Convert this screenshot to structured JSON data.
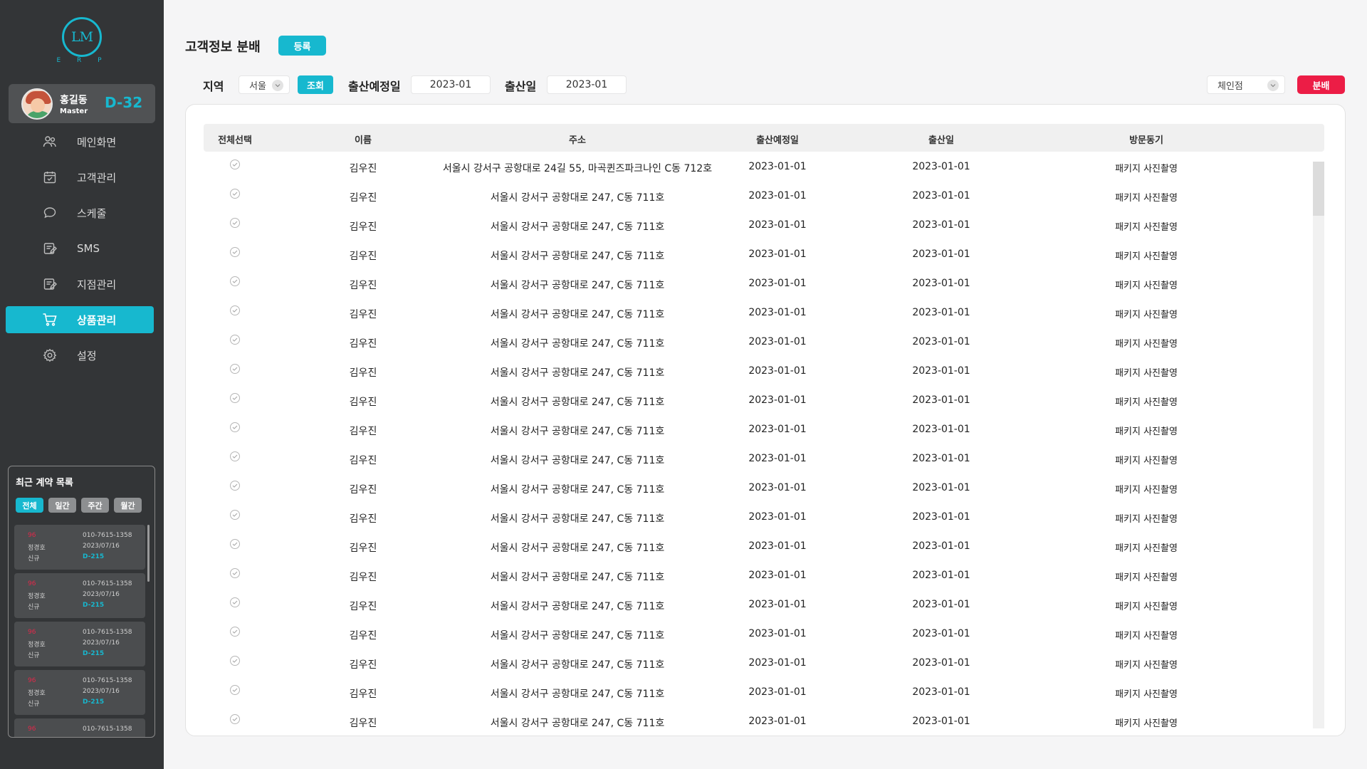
{
  "sidebar": {
    "logo_text": "LM",
    "logo_sub": "E R P",
    "profile": {
      "name": "홍길동",
      "role": "Master",
      "dday": "D-32"
    },
    "nav": [
      {
        "label": "메인화면",
        "icon": "users-icon"
      },
      {
        "label": "고객관리",
        "icon": "calendar-check-icon"
      },
      {
        "label": "스케줄",
        "icon": "chat-bubble-icon"
      },
      {
        "label": "SMS",
        "icon": "message-edit-icon"
      },
      {
        "label": "지점관리",
        "icon": "branch-edit-icon"
      },
      {
        "label": "상품관리",
        "icon": "cart-icon",
        "active": true
      },
      {
        "label": "설정",
        "icon": "gear-icon"
      }
    ],
    "recent": {
      "title": "최근 계약 목록",
      "tabs": [
        "전체",
        "일간",
        "주간",
        "월간"
      ],
      "cards": [
        {
          "code": "96",
          "name": "정경호",
          "type": "신규",
          "phone": "010-7615-1358",
          "date": "2023/07/16",
          "dday": "D-215"
        },
        {
          "code": "96",
          "name": "정경호",
          "type": "신규",
          "phone": "010-7615-1358",
          "date": "2023/07/16",
          "dday": "D-215"
        },
        {
          "code": "96",
          "name": "정경호",
          "type": "신규",
          "phone": "010-7615-1358",
          "date": "2023/07/16",
          "dday": "D-215"
        },
        {
          "code": "96",
          "name": "정경호",
          "type": "신규",
          "phone": "010-7615-1358",
          "date": "2023/07/16",
          "dday": "D-215"
        },
        {
          "code": "96",
          "name": "",
          "type": "",
          "phone": "010-7615-1358",
          "date": "",
          "dday": ""
        }
      ]
    }
  },
  "header": {
    "title": "고객정보 분배",
    "register_label": "등록"
  },
  "filters": {
    "region_label": "지역",
    "region_value": "서울",
    "search_label": "조회",
    "due_label": "출산예정일",
    "due_value": "2023-01",
    "birth_label": "출산일",
    "birth_value": "2023-01",
    "branch_value": "체인점",
    "distribute_label": "분배"
  },
  "table": {
    "columns": [
      "전체선택",
      "이름",
      "주소",
      "출산예정일",
      "출산일",
      "방문동기"
    ],
    "rows": [
      {
        "name": "김우진",
        "address": "서울시 강서구 공항대로 24길 55, 마곡퀸즈파크나인 C동 712호",
        "due": "2023-01-01",
        "birth": "2023-01-01",
        "motive": "패키지 사진촬영"
      },
      {
        "name": "김우진",
        "address": "서울시 강서구 공항대로 247, C동 711호",
        "due": "2023-01-01",
        "birth": "2023-01-01",
        "motive": "패키지 사진촬영"
      },
      {
        "name": "김우진",
        "address": "서울시 강서구 공항대로 247, C동 711호",
        "due": "2023-01-01",
        "birth": "2023-01-01",
        "motive": "패키지 사진촬영"
      },
      {
        "name": "김우진",
        "address": "서울시 강서구 공항대로 247, C동 711호",
        "due": "2023-01-01",
        "birth": "2023-01-01",
        "motive": "패키지 사진촬영"
      },
      {
        "name": "김우진",
        "address": "서울시 강서구 공항대로 247, C동 711호",
        "due": "2023-01-01",
        "birth": "2023-01-01",
        "motive": "패키지 사진촬영"
      },
      {
        "name": "김우진",
        "address": "서울시 강서구 공항대로 247, C동 711호",
        "due": "2023-01-01",
        "birth": "2023-01-01",
        "motive": "패키지 사진촬영"
      },
      {
        "name": "김우진",
        "address": "서울시 강서구 공항대로 247, C동 711호",
        "due": "2023-01-01",
        "birth": "2023-01-01",
        "motive": "패키지 사진촬영"
      },
      {
        "name": "김우진",
        "address": "서울시 강서구 공항대로 247, C동 711호",
        "due": "2023-01-01",
        "birth": "2023-01-01",
        "motive": "패키지 사진촬영"
      },
      {
        "name": "김우진",
        "address": "서울시 강서구 공항대로 247, C동 711호",
        "due": "2023-01-01",
        "birth": "2023-01-01",
        "motive": "패키지 사진촬영"
      },
      {
        "name": "김우진",
        "address": "서울시 강서구 공항대로 247, C동 711호",
        "due": "2023-01-01",
        "birth": "2023-01-01",
        "motive": "패키지 사진촬영"
      },
      {
        "name": "김우진",
        "address": "서울시 강서구 공항대로 247, C동 711호",
        "due": "2023-01-01",
        "birth": "2023-01-01",
        "motive": "패키지 사진촬영"
      },
      {
        "name": "김우진",
        "address": "서울시 강서구 공항대로 247, C동 711호",
        "due": "2023-01-01",
        "birth": "2023-01-01",
        "motive": "패키지 사진촬영"
      },
      {
        "name": "김우진",
        "address": "서울시 강서구 공항대로 247, C동 711호",
        "due": "2023-01-01",
        "birth": "2023-01-01",
        "motive": "패키지 사진촬영"
      },
      {
        "name": "김우진",
        "address": "서울시 강서구 공항대로 247, C동 711호",
        "due": "2023-01-01",
        "birth": "2023-01-01",
        "motive": "패키지 사진촬영"
      },
      {
        "name": "김우진",
        "address": "서울시 강서구 공항대로 247, C동 711호",
        "due": "2023-01-01",
        "birth": "2023-01-01",
        "motive": "패키지 사진촬영"
      },
      {
        "name": "김우진",
        "address": "서울시 강서구 공항대로 247, C동 711호",
        "due": "2023-01-01",
        "birth": "2023-01-01",
        "motive": "패키지 사진촬영"
      },
      {
        "name": "김우진",
        "address": "서울시 강서구 공항대로 247, C동 711호",
        "due": "2023-01-01",
        "birth": "2023-01-01",
        "motive": "패키지 사진촬영"
      },
      {
        "name": "김우진",
        "address": "서울시 강서구 공항대로 247, C동 711호",
        "due": "2023-01-01",
        "birth": "2023-01-01",
        "motive": "패키지 사진촬영"
      },
      {
        "name": "김우진",
        "address": "서울시 강서구 공항대로 247, C동 711호",
        "due": "2023-01-01",
        "birth": "2023-01-01",
        "motive": "패키지 사진촬영"
      },
      {
        "name": "김우진",
        "address": "서울시 강서구 공항대로 247, C동 711호",
        "due": "2023-01-01",
        "birth": "2023-01-01",
        "motive": "패키지 사진촬영"
      }
    ]
  },
  "colors": {
    "accent": "#17b8cf",
    "danger": "#ec1d46",
    "sidebar": "#333537"
  }
}
